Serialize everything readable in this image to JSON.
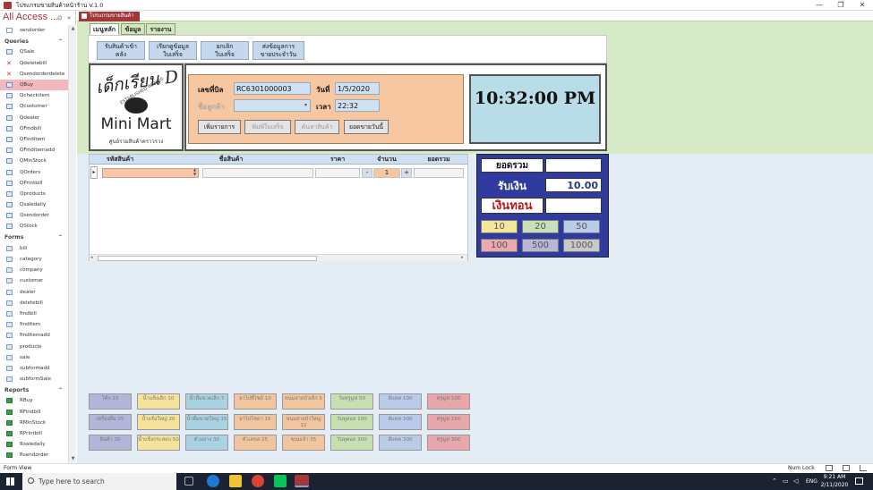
{
  "window": {
    "title": "โปรแกรมขายสินค้าหน้าร้าน V.1.0",
    "min": "—",
    "max": "❐",
    "close": "✕"
  },
  "nav": {
    "title": "All Access ...",
    "search_icon": "search-icon",
    "collapse": "«",
    "top_item": "sendorder",
    "groups": [
      {
        "name": "Queries",
        "chev": "⌃",
        "items": [
          {
            "label": "QSale",
            "icon": "qa"
          },
          {
            "label": "Qdeletebill",
            "icon": "qd"
          },
          {
            "label": "Qsendorderdelete",
            "icon": "qd"
          },
          {
            "label": "QBuy",
            "icon": "q",
            "selected": true
          },
          {
            "label": "Qcheckitem",
            "icon": "q"
          },
          {
            "label": "Qcustomer",
            "icon": "q"
          },
          {
            "label": "Qdealer",
            "icon": "q"
          },
          {
            "label": "QFindbill",
            "icon": "q"
          },
          {
            "label": "QFinditem",
            "icon": "q"
          },
          {
            "label": "QFinditemadd",
            "icon": "q"
          },
          {
            "label": "QMinStock",
            "icon": "q"
          },
          {
            "label": "QOrders",
            "icon": "q"
          },
          {
            "label": "QPrintbill",
            "icon": "q"
          },
          {
            "label": "Qproducts",
            "icon": "q"
          },
          {
            "label": "Qsaledaily",
            "icon": "q"
          },
          {
            "label": "Qsendorder",
            "icon": "q"
          },
          {
            "label": "QStock",
            "icon": "q"
          }
        ]
      },
      {
        "name": "Forms",
        "chev": "⌃",
        "items": [
          {
            "label": "bill",
            "icon": "f"
          },
          {
            "label": "category",
            "icon": "f"
          },
          {
            "label": "company",
            "icon": "f"
          },
          {
            "label": "customer",
            "icon": "f"
          },
          {
            "label": "dealer",
            "icon": "f"
          },
          {
            "label": "deletebill",
            "icon": "f"
          },
          {
            "label": "findbill",
            "icon": "f"
          },
          {
            "label": "finditem",
            "icon": "f"
          },
          {
            "label": "finditemadd",
            "icon": "f"
          },
          {
            "label": "products",
            "icon": "f"
          },
          {
            "label": "sale",
            "icon": "f"
          },
          {
            "label": "subformadd",
            "icon": "f"
          },
          {
            "label": "subformSale",
            "icon": "f"
          }
        ]
      },
      {
        "name": "Reports",
        "chev": "⌃",
        "items": [
          {
            "label": "RBuy",
            "icon": "r"
          },
          {
            "label": "RFindbill",
            "icon": "r"
          },
          {
            "label": "RMinStock",
            "icon": "r"
          },
          {
            "label": "RPrintbill",
            "icon": "r"
          },
          {
            "label": "Rsaledaily",
            "icon": "r"
          },
          {
            "label": "Rsendorder",
            "icon": "r"
          },
          {
            "label": "RStock",
            "icon": "r"
          }
        ]
      }
    ]
  },
  "doc_tab": "โปรแกรมขายสินค้า",
  "form_tabs": [
    "เมนูหลัก",
    "ข้อมูล",
    "รายงาน"
  ],
  "menu_buttons": [
    {
      "l1": "รับสินค้าเข้า",
      "l2": "คลัง"
    },
    {
      "l1": "เรียกดูข้อมูล",
      "l2": "ใบเสร็จ"
    },
    {
      "l1": "ยกเลิก",
      "l2": "ใบเสร็จ"
    },
    {
      "l1": "ส่งข้อมูลการ",
      "l2": "ขายประจำวัน"
    }
  ],
  "logo": {
    "thai": "เด็กเรียน D",
    "est": "ESTABLISHED IN 2020",
    "brand": "Mini Mart",
    "sub": "ศูนย์รวมสินค้าคราวรวง"
  },
  "bill": {
    "bill_no_label": "เลขที่บิล",
    "bill_no": "RC6301000003",
    "date_label": "วันที่",
    "date": "1/5/2020",
    "customer_label": "ชื่อลูกค้า",
    "customer": "",
    "time_label": "เวลา",
    "time": "22:32",
    "actions": [
      {
        "label": "เพิ่มรายการ",
        "disabled": false
      },
      {
        "label": "พิมพ์ใบเสร็จ",
        "disabled": true
      },
      {
        "label": "ค้นหาสินค้า",
        "disabled": true
      },
      {
        "label": "ยอดขายวันนี้",
        "disabled": false
      }
    ]
  },
  "clock": "10:32:00 PM",
  "grid": {
    "headers": [
      "รหัสสินค้า",
      "ชื่อสินค้า",
      "ราคา",
      "จำนวน",
      "ยอดรวม"
    ],
    "row": {
      "code": "",
      "name": "",
      "price": "",
      "minus": "-",
      "qty": "1",
      "plus": "+",
      "total": ""
    }
  },
  "totals": {
    "total_label": "ยอดรวม",
    "total": "",
    "receive_label": "รับเงิน",
    "receive": "10.00",
    "change_label": "เงินทอน",
    "change": "",
    "cash": [
      {
        "label": "10",
        "color": "#f5e79a"
      },
      {
        "label": "20",
        "color": "#c9dfb8"
      },
      {
        "label": "50",
        "color": "#b9cde8"
      },
      {
        "label": "100",
        "color": "#e9a9ae"
      },
      {
        "label": "500",
        "color": "#b9b7d8"
      },
      {
        "label": "1000",
        "color": "#c9c9c9"
      }
    ]
  },
  "quick": [
    [
      {
        "label": "โค้ก 15",
        "color": "#b3b5d9"
      },
      {
        "label": "น้ำแข็งเล็ก 10",
        "color": "#f6e39a"
      },
      {
        "label": "น้ำดื่มขวดเล็ก 7",
        "color": "#a9d3e3"
      },
      {
        "label": "ยาไปที่ไซด์ 10",
        "color": "#f1c69f"
      },
      {
        "label": "ขนมสายบัวเล็ก 5",
        "color": "#f1c69f"
      },
      {
        "label": "วันทรูมูฟ 50",
        "color": "#c8dfb1"
      },
      {
        "label": "ดีแทค 100",
        "color": "#b9cbe8"
      },
      {
        "label": "ทรูมูฟ 100",
        "color": "#e7a7ab"
      }
    ],
    [
      {
        "label": "เครื่องดื่ม 25",
        "color": "#b3b5d9"
      },
      {
        "label": "น้ำแข็งใหญ่ 20",
        "color": "#f6e39a"
      },
      {
        "label": "น้ำดื่มขวดใหญ่ 15",
        "color": "#a9d3e3"
      },
      {
        "label": "ยาไปโซดา 15",
        "color": "#f1c69f"
      },
      {
        "label": "ขนมสายบัวใหญ่ 12",
        "color": "#f1c69f"
      },
      {
        "label": "วันทูคอล 100",
        "color": "#c8dfb1"
      },
      {
        "label": "ดีแทค 200",
        "color": "#b9cbe8"
      },
      {
        "label": "ทรูมูฟ 150",
        "color": "#e7a7ab"
      }
    ],
    [
      {
        "label": "สินค้า 30",
        "color": "#b3b5d9"
      },
      {
        "label": "น้ำแข็งกระสอบ 50",
        "color": "#f6e39a"
      },
      {
        "label": "ตัวอย่าง 30",
        "color": "#a9d3e3"
      },
      {
        "label": "ตัวเลขล 25",
        "color": "#f1c69f"
      },
      {
        "label": "ขนมเจ้า 35",
        "color": "#f1c69f"
      },
      {
        "label": "วันทูคอล 300",
        "color": "#c8dfb1"
      },
      {
        "label": "ดีแทค 300",
        "color": "#b9cbe8"
      },
      {
        "label": "ทรูมูฟ 300",
        "color": "#e7a7ab"
      }
    ]
  ],
  "status": {
    "left": "Form View",
    "numlock": "Num Lock"
  },
  "taskbar": {
    "search": "Type here to search",
    "lang": "ENG",
    "time": "9:21 AM",
    "date": "2/11/2020"
  }
}
